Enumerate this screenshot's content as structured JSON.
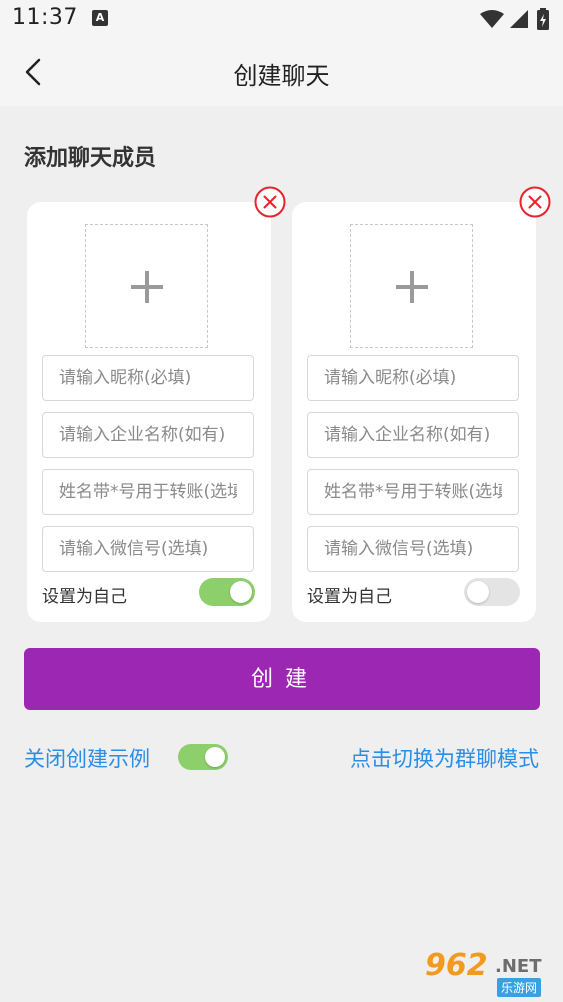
{
  "status_bar": {
    "time": "11:37",
    "notification_icon": "A"
  },
  "header": {
    "title": "创建聊天"
  },
  "section": {
    "title": "添加聊天成员"
  },
  "members": [
    {
      "nickname_placeholder": "请输入昵称(必填)",
      "company_placeholder": "请输入企业名称(如有)",
      "name_placeholder": "姓名带*号用于转账(选填)",
      "wechat_placeholder": "请输入微信号(选填)",
      "self_label": "设置为自己",
      "set_as_self": true
    },
    {
      "nickname_placeholder": "请输入昵称(必填)",
      "company_placeholder": "请输入企业名称(如有)",
      "name_placeholder": "姓名带*号用于转账(选填)",
      "wechat_placeholder": "请输入微信号(选填)",
      "self_label": "设置为自己",
      "set_as_self": false
    }
  ],
  "create_button": {
    "label": "创建"
  },
  "footer": {
    "close_example_label": "关闭创建示例",
    "close_example_on": true,
    "switch_group_label": "点击切换为群聊模式"
  },
  "watermark": {
    "brand": "962",
    "suffix": ".NET",
    "sub": "乐游网"
  },
  "colors": {
    "accent": "#9b27b3",
    "link": "#2b8ee6",
    "toggle_on": "#8dcf6a",
    "remove_red": "#e8232a"
  },
  "icons": [
    "back-arrow-icon",
    "remove-circle-icon",
    "plus-icon",
    "wifi-icon",
    "signal-icon",
    "battery-icon"
  ]
}
